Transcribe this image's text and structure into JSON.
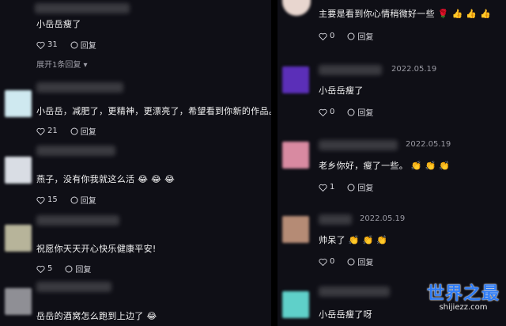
{
  "left": {
    "comments": [
      {
        "text": "小岳岳瘦了",
        "emoji": "",
        "likes": "31",
        "reply_label": "回复",
        "expand": "展开1条回复"
      },
      {
        "text": "小岳岳，减肥了，更精神，更漂亮了，希望看到你新的作品。",
        "emoji": "",
        "likes": "21",
        "reply_label": "回复"
      },
      {
        "text": "燕子，没有你我就这么活",
        "emoji": "😂 😂 😂",
        "likes": "15",
        "reply_label": "回复"
      },
      {
        "text": "祝愿你天天开心快乐健康平安!",
        "emoji": "",
        "likes": "5",
        "reply_label": "回复"
      },
      {
        "text": "岳岳的酒窝怎么跑到上边了",
        "emoji": "😂",
        "likes": "",
        "reply_label": ""
      }
    ]
  },
  "right": {
    "comments": [
      {
        "text": "主要是看到你心情稍微好一些",
        "emoji": "🌹 👍 👍 👍",
        "date": "",
        "likes": "0",
        "reply_label": "回复"
      },
      {
        "text": "小岳岳瘦了",
        "emoji": "",
        "date": "2022.05.19",
        "likes": "0",
        "reply_label": "回复"
      },
      {
        "text": "老乡你好，瘦了一些。",
        "emoji": "👏 👏 👏",
        "date": "2022.05.19",
        "likes": "1",
        "reply_label": "回复"
      },
      {
        "text": "帅呆了",
        "emoji": "👏 👏 👏",
        "date": "2022.05.19",
        "likes": "0",
        "reply_label": "回复"
      },
      {
        "text": "小岳岳瘦了呀",
        "emoji": "",
        "date": "",
        "likes": "",
        "reply_label": ""
      }
    ]
  },
  "watermark": {
    "title": "世界之最",
    "url": "shijiezz.com"
  },
  "colors": {
    "background": "#0f0f16",
    "watermark": "#2f7cf5"
  }
}
